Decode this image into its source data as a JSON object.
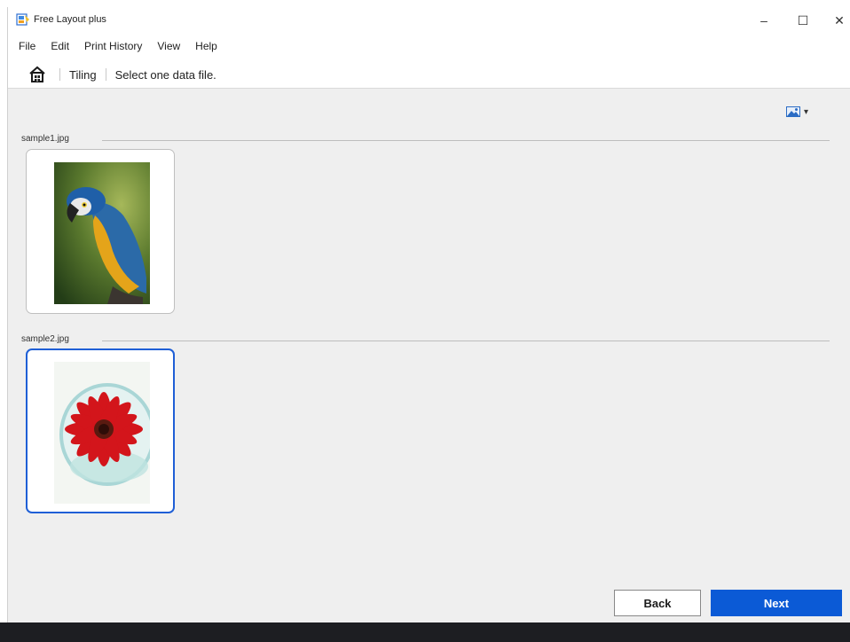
{
  "window": {
    "title": "Free Layout plus",
    "controls": {
      "minimize": "–",
      "maximize": "☐",
      "close": "✕"
    }
  },
  "menu": [
    "File",
    "Edit",
    "Print History",
    "View",
    "Help"
  ],
  "breadcrumb": {
    "home_icon": "home-icon",
    "mode": "Tiling",
    "instruction": "Select one data file."
  },
  "toolbar": {
    "view_toggle_icon": "image-view-icon",
    "dropdown_glyph": "▾"
  },
  "files": [
    {
      "name": "sample1.jpg",
      "selected": false,
      "thumbnail": "parrot-photo"
    },
    {
      "name": "sample2.jpg",
      "selected": true,
      "thumbnail": "red-flower-photo"
    }
  ],
  "buttons": {
    "back": "Back",
    "next": "Next"
  },
  "colors": {
    "accent": "#0b5ad6",
    "selection": "#1f5fd6",
    "content_bg": "#efefef",
    "taskbar": "#1d1e22"
  }
}
